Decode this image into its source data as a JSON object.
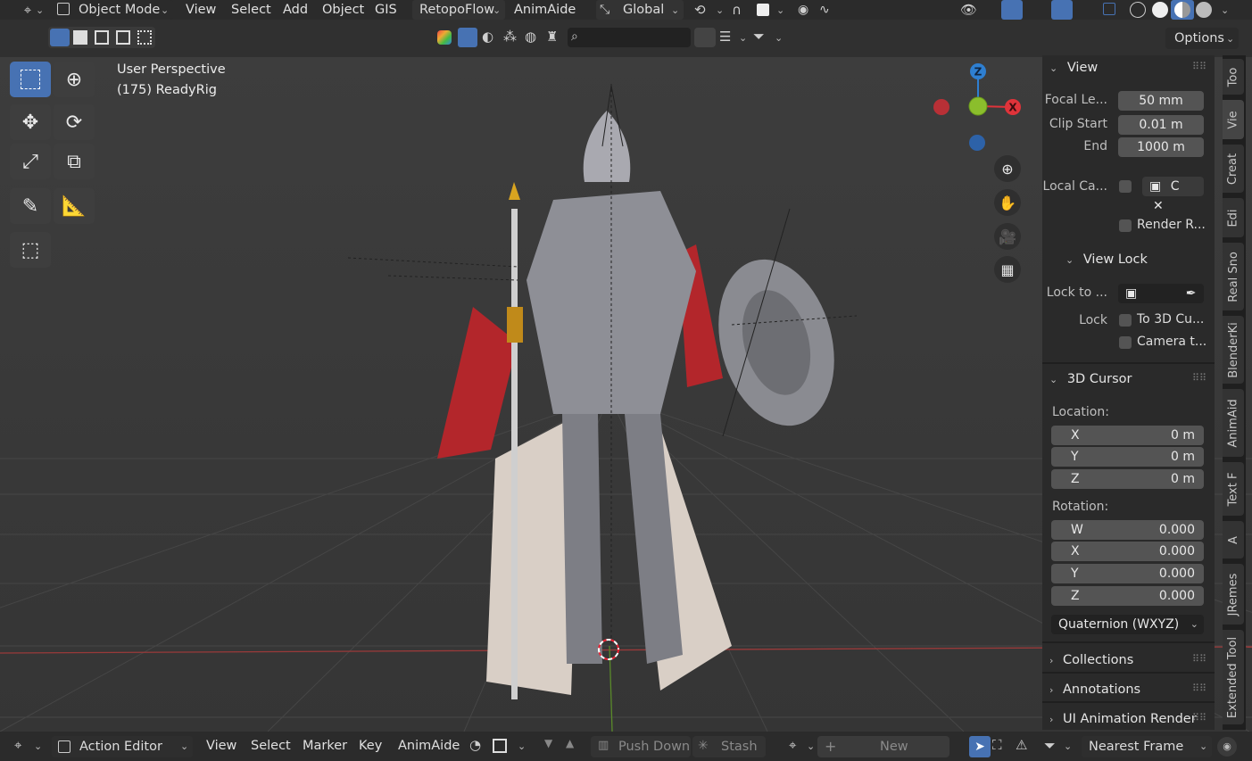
{
  "header": {
    "mode": "Object Mode",
    "menus": [
      "View",
      "Select",
      "Add",
      "Object",
      "GIS"
    ],
    "addons": [
      "RetopoFlow",
      "AnimAide"
    ],
    "orientation": "Global",
    "options": "Options"
  },
  "viewport": {
    "perspective_label": "User Perspective",
    "object_label": "(175) ReadyRig",
    "axis_labels": {
      "z": "Z",
      "x": "X"
    }
  },
  "npanel": {
    "view": {
      "title": "View",
      "focal_label": "Focal Le...",
      "focal_value": "50 mm",
      "clip_start_label": "Clip Start",
      "clip_start_value": "0.01 m",
      "end_label": "End",
      "end_value": "1000 m",
      "local_camera_label": "Local Ca...",
      "local_camera_value": "C",
      "render_region_label": "Render R..."
    },
    "view_lock": {
      "title": "View Lock",
      "lock_to_label": "Lock to ...",
      "lock_label": "Lock",
      "to_3d_cursor": "To 3D Cu...",
      "camera_to_view": "Camera t..."
    },
    "cursor": {
      "title": "3D Cursor",
      "location_label": "Location:",
      "location": [
        {
          "axis": "X",
          "value": "0 m"
        },
        {
          "axis": "Y",
          "value": "0 m"
        },
        {
          "axis": "Z",
          "value": "0 m"
        }
      ],
      "rotation_label": "Rotation:",
      "rotation": [
        {
          "axis": "W",
          "value": "0.000"
        },
        {
          "axis": "X",
          "value": "0.000"
        },
        {
          "axis": "Y",
          "value": "0.000"
        },
        {
          "axis": "Z",
          "value": "0.000"
        }
      ],
      "rotation_mode": "Quaternion (WXYZ)"
    },
    "collapsed_panels": [
      "Collections",
      "Annotations",
      "UI Animation Render"
    ]
  },
  "sidebar_tabs": [
    "Too",
    "Vie",
    "Creat",
    "Edi",
    "Real Sno",
    "BlenderKi",
    "AnimAid",
    "Text F",
    "A",
    "JRemes",
    "Extended Tool"
  ],
  "bottom": {
    "editor": "Action Editor",
    "menus": [
      "View",
      "Select",
      "Marker",
      "Key",
      "AnimAide"
    ],
    "push_down": "Push Down",
    "stash": "Stash",
    "new": "New",
    "snap": "Nearest Frame"
  },
  "colors": {
    "accent": "#4772b3",
    "axis_x": "#e0333a",
    "axis_y": "#8bbe2c",
    "axis_z": "#2e7fd1"
  }
}
